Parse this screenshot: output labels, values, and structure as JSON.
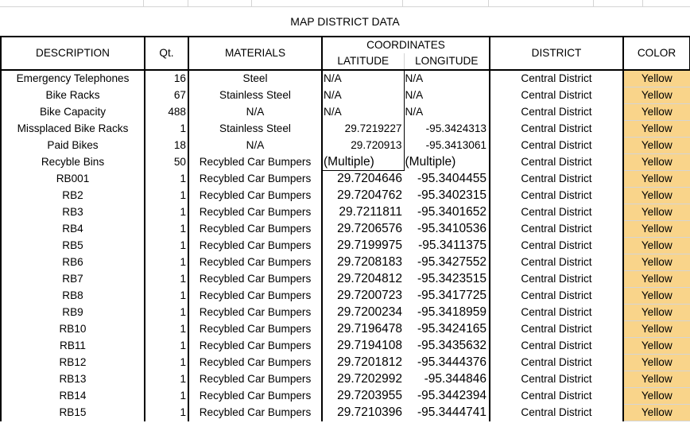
{
  "title": "MAP DISTRICT DATA",
  "headers": {
    "description": "DESCRIPTION",
    "qty": "Qt.",
    "materials": "MATERIALS",
    "coordinates": "COORDINATES",
    "latitude": "LATITUDE",
    "longitude": "LONGITUDE",
    "district": "DISTRICT",
    "color": "COLOR"
  },
  "colors": {
    "highlight": "#f9d48a"
  },
  "rows": [
    {
      "desc": "Emergency Telephones",
      "qty": "16",
      "mat": "Steel",
      "lat": "N/A",
      "lon": "N/A",
      "district": "Central District",
      "color": "Yellow"
    },
    {
      "desc": "Bike Racks",
      "qty": "67",
      "mat": "Stainless Steel",
      "lat": "N/A",
      "lon": "N/A",
      "district": "Central District",
      "color": "Yellow"
    },
    {
      "desc": "Bike Capacity",
      "qty": "488",
      "mat": "N/A",
      "lat": "N/A",
      "lon": "N/A",
      "district": "Central District",
      "color": "Yellow"
    },
    {
      "desc": "Missplaced Bike Racks",
      "qty": "1",
      "mat": "Stainless Steel",
      "lat": "29.7219227",
      "lon": "-95.3424313",
      "district": "Central District",
      "color": "Yellow"
    },
    {
      "desc": "Paid Bikes",
      "qty": "18",
      "mat": "N/A",
      "lat": "29.720913",
      "lon": "-95.3413061",
      "district": "Central District",
      "color": "Yellow"
    },
    {
      "desc": "Recyble Bins",
      "qty": "50",
      "mat": "Recybled Car Bumpers",
      "lat": "(Multiple)",
      "lon": "(Multiple)",
      "district": "Central District",
      "color": "Yellow"
    },
    {
      "desc": "RB001",
      "qty": "1",
      "mat": "Recybled Car Bumpers",
      "lat": "29.7204646",
      "lon": "-95.3404455",
      "district": "Central District",
      "color": "Yellow"
    },
    {
      "desc": "RB2",
      "qty": "1",
      "mat": "Recybled Car Bumpers",
      "lat": "29.7204762",
      "lon": "-95.3402315",
      "district": "Central District",
      "color": "Yellow"
    },
    {
      "desc": "RB3",
      "qty": "1",
      "mat": "Recybled Car Bumpers",
      "lat": "29.7211811",
      "lon": "-95.3401652",
      "district": "Central District",
      "color": "Yellow"
    },
    {
      "desc": "RB4",
      "qty": "1",
      "mat": "Recybled Car Bumpers",
      "lat": "29.7206576",
      "lon": "-95.3410536",
      "district": "Central District",
      "color": "Yellow"
    },
    {
      "desc": "RB5",
      "qty": "1",
      "mat": "Recybled Car Bumpers",
      "lat": "29.7199975",
      "lon": "-95.3411375",
      "district": "Central District",
      "color": "Yellow"
    },
    {
      "desc": "RB6",
      "qty": "1",
      "mat": "Recybled Car Bumpers",
      "lat": "29.7208183",
      "lon": "-95.3427552",
      "district": "Central District",
      "color": "Yellow"
    },
    {
      "desc": "RB7",
      "qty": "1",
      "mat": "Recybled Car Bumpers",
      "lat": "29.7204812",
      "lon": "-95.3423515",
      "district": "Central District",
      "color": "Yellow"
    },
    {
      "desc": "RB8",
      "qty": "1",
      "mat": "Recybled Car Bumpers",
      "lat": "29.7200723",
      "lon": "-95.3417725",
      "district": "Central District",
      "color": "Yellow"
    },
    {
      "desc": "RB9",
      "qty": "1",
      "mat": "Recybled Car Bumpers",
      "lat": "29.7200234",
      "lon": "-95.3418959",
      "district": "Central District",
      "color": "Yellow"
    },
    {
      "desc": "RB10",
      "qty": "1",
      "mat": "Recybled Car Bumpers",
      "lat": "29.7196478",
      "lon": "-95.3424165",
      "district": "Central District",
      "color": "Yellow"
    },
    {
      "desc": "RB11",
      "qty": "1",
      "mat": "Recybled Car Bumpers",
      "lat": "29.7194108",
      "lon": "-95.3435632",
      "district": "Central District",
      "color": "Yellow"
    },
    {
      "desc": "RB12",
      "qty": "1",
      "mat": "Recybled Car Bumpers",
      "lat": "29.7201812",
      "lon": "-95.3444376",
      "district": "Central District",
      "color": "Yellow"
    },
    {
      "desc": "RB13",
      "qty": "1",
      "mat": "Recybled Car Bumpers",
      "lat": "29.7202992",
      "lon": "-95.344846",
      "district": "Central District",
      "color": "Yellow"
    },
    {
      "desc": "RB14",
      "qty": "1",
      "mat": "Recybled Car Bumpers",
      "lat": "29.7203955",
      "lon": "-95.3442394",
      "district": "Central District",
      "color": "Yellow"
    },
    {
      "desc": "RB15",
      "qty": "1",
      "mat": "Recybled Car Bumpers",
      "lat": "29.7210396",
      "lon": "-95.3444741",
      "district": "Central District",
      "color": "Yellow"
    }
  ]
}
